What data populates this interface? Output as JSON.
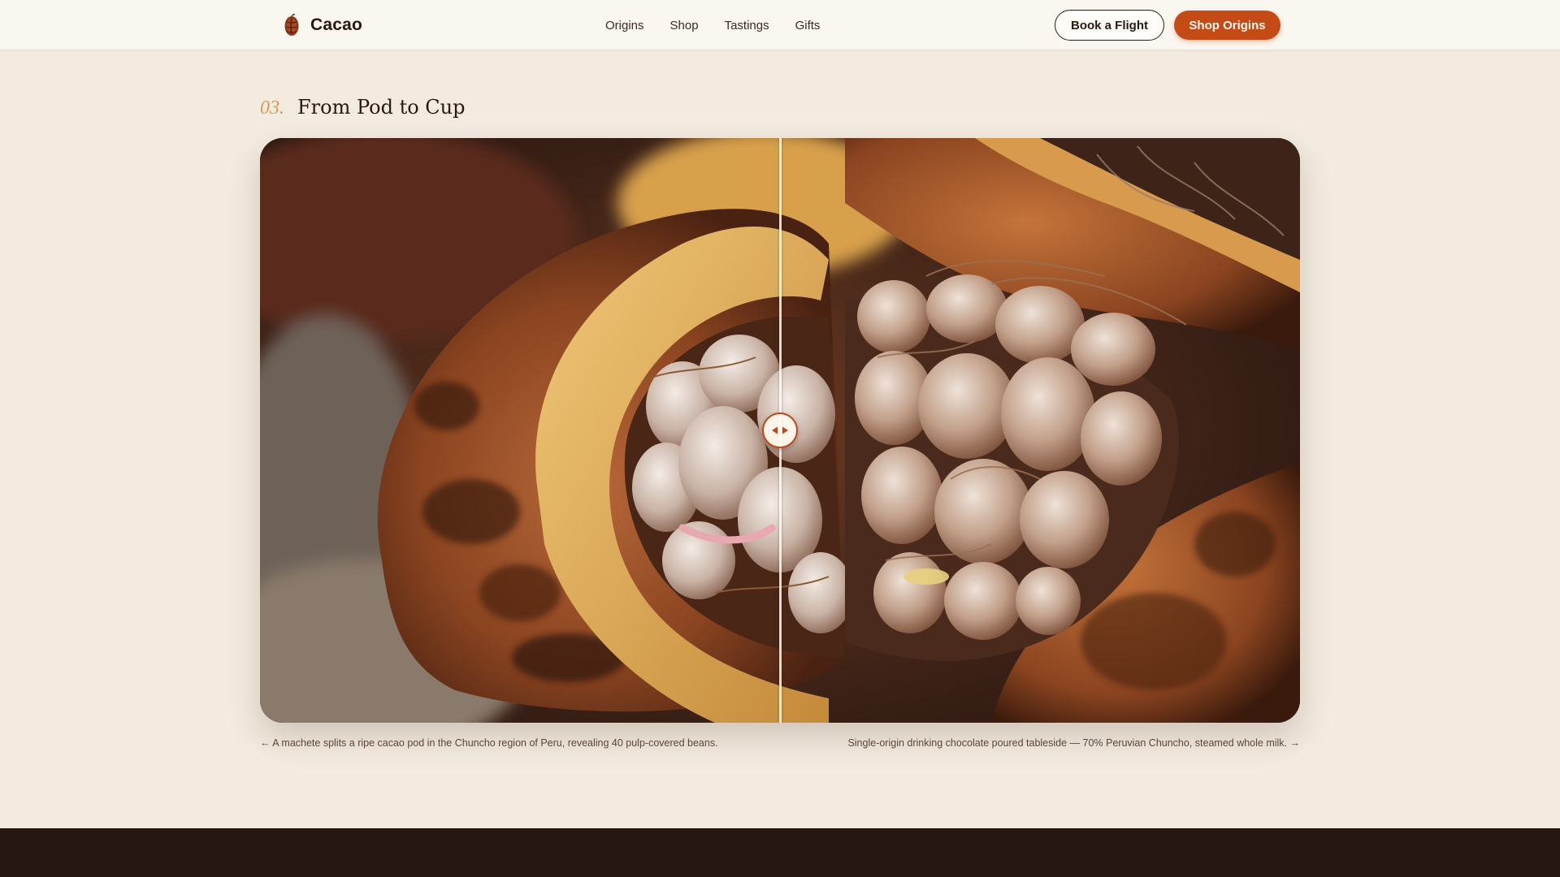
{
  "header": {
    "brand_name": "Cacao",
    "nav": [
      "Origins",
      "Shop",
      "Tastings",
      "Gifts"
    ],
    "book_label": "Book a Flight",
    "shop_label": "Shop Origins"
  },
  "section": {
    "number": "03.",
    "title": "From Pod to Cup"
  },
  "compare": {
    "position_percent": 50,
    "before_alt": "Ripe cacao pod split open",
    "after_alt": "Cacao beans close-up"
  },
  "captions": {
    "left": "← A machete splits a ripe cacao pod in the Chuncho region of Peru, revealing 40 pulp-covered beans.",
    "right": "Single-origin drinking chocolate poured tableside — 70% Peruvian Chuncho, steamed whole milk. →"
  },
  "colors": {
    "accent": "#c44a16",
    "background": "#f3ebe0",
    "footer": "#271711",
    "section_number": "#d49b5a"
  }
}
